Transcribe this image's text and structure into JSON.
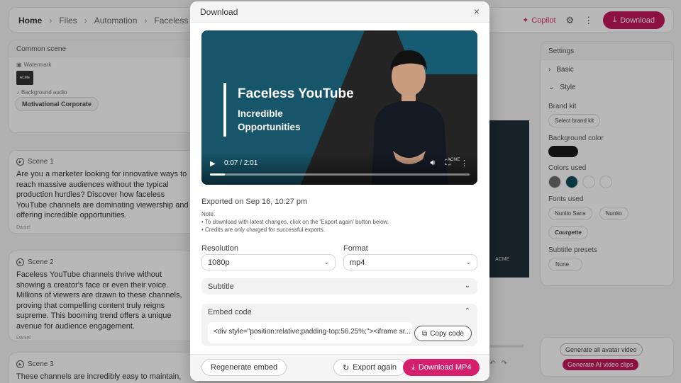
{
  "app": {
    "breadcrumbs": [
      "Home",
      "Files",
      "Automation",
      "Faceless YouTu"
    ],
    "copilot_label": "Copilot",
    "download_label": "Download",
    "common_scene": {
      "title": "Common scene",
      "watermark_label": "Watermark",
      "logo_text": "ACME",
      "background_audio_label": "Background audio",
      "audio_chip": "Motivational Corporate"
    },
    "scenes": [
      {
        "title": "Scene 1",
        "text": "Are you a marketer looking for innovative ways to reach massive audiences without the typical production hurdles? Discover how faceless YouTube channels are dominating viewership and offering incredible opportunities.",
        "avatar": "Daniel"
      },
      {
        "title": "Scene 2",
        "text": "Faceless YouTube channels thrive without showing a creator's face or even their voice. Millions of viewers are drawn to these channels, proving that compelling content truly reigns supreme. This booming trend offers a unique avenue for audience engagement.",
        "avatar": "Daniel"
      },
      {
        "title": "Scene 3",
        "text": "These channels are incredibly easy to maintain, saving"
      }
    ],
    "preview_logo": "ACME",
    "settings": {
      "title": "Settings",
      "basic_label": "Basic",
      "style_label": "Style",
      "brand_kit_label": "Brand kit",
      "brand_kit_value": "Select brand kit",
      "background_color_label": "Background color",
      "colors_used_label": "Colors used",
      "fonts_used_label": "Fonts used",
      "font_1": "Nunito Sans",
      "font_2": "Nunito",
      "font_3": "Courgette",
      "subtitle_presets_label": "Subtitle presets",
      "subtitle_presets_value": "None",
      "generate_avatar_label": "Generate all avatar video",
      "generate_ai_clips_label": "Generate AI video clips"
    }
  },
  "modal": {
    "title": "Download",
    "video": {
      "title": "Faceless YouTube",
      "subtitle": "Incredible Opportunities",
      "time": "0:07 / 2:01",
      "progress": 0.058,
      "logo": "ACME"
    },
    "exported_text": "Exported on Sep 16, 10:27 pm",
    "note_label": "Note:",
    "notes": [
      "To download with latest changes, click on the 'Export again' button below.",
      "Credits are only charged for successful exports."
    ],
    "resolution_label": "Resolution",
    "resolution_value": "1080p",
    "format_label": "Format",
    "format_value": "mp4",
    "subtitle_label": "Subtitle",
    "embed_label": "Embed code",
    "embed_code": "<div style=\"position:relative;padding-top:56.25%;\"><iframe sr...",
    "copy_code_label": "Copy code",
    "regenerate_label": "Regenerate embed",
    "export_again_label": "Export again",
    "download_mp4_label": "Download MP4"
  },
  "colors": {
    "accent": "#d41f6d",
    "video_teal": "#16556a",
    "bg_color_swatch": "#1a1a1a",
    "swatches": [
      "#6b6b6b",
      "#0f4a5c",
      "#ffffff",
      "#ffffff"
    ]
  }
}
